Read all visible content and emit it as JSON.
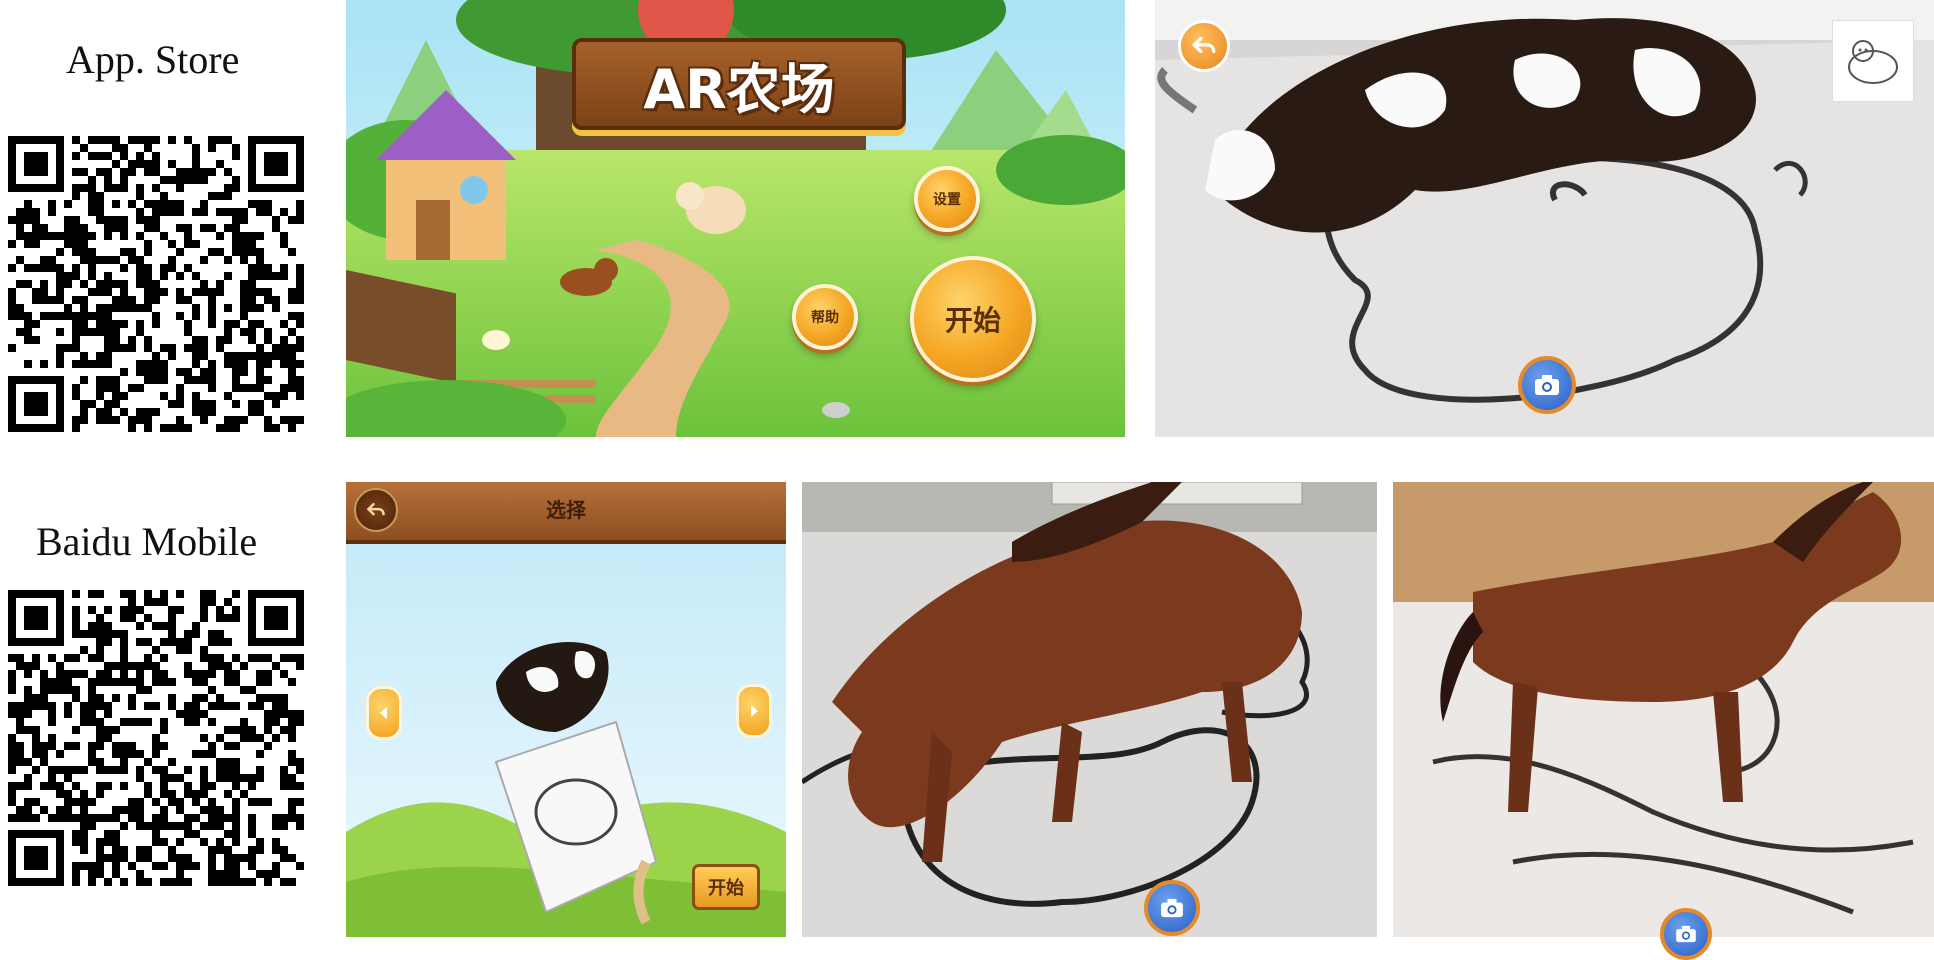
{
  "labels": {
    "app_store": "App. Store",
    "baidu_mobile": "Baidu Mobile"
  },
  "menu_screen": {
    "title": "AR农场",
    "settings_label": "设置",
    "help_label": "帮助",
    "start_label": "开始"
  },
  "select_screen": {
    "title": "选择",
    "start_label": "开始"
  },
  "icons": {
    "back": "back-arrow-icon",
    "camera": "camera-icon",
    "left_arrow": "left-arrow-icon",
    "right_arrow": "right-arrow-icon",
    "mascot": "cow-mascot-icon"
  },
  "colors": {
    "button_orange": "#f5a623",
    "camera_blue": "#2c5fc4",
    "wood_brown": "#8d4f22",
    "grass_green": "#8fd14f",
    "sky_blue": "#bfe8f7"
  }
}
